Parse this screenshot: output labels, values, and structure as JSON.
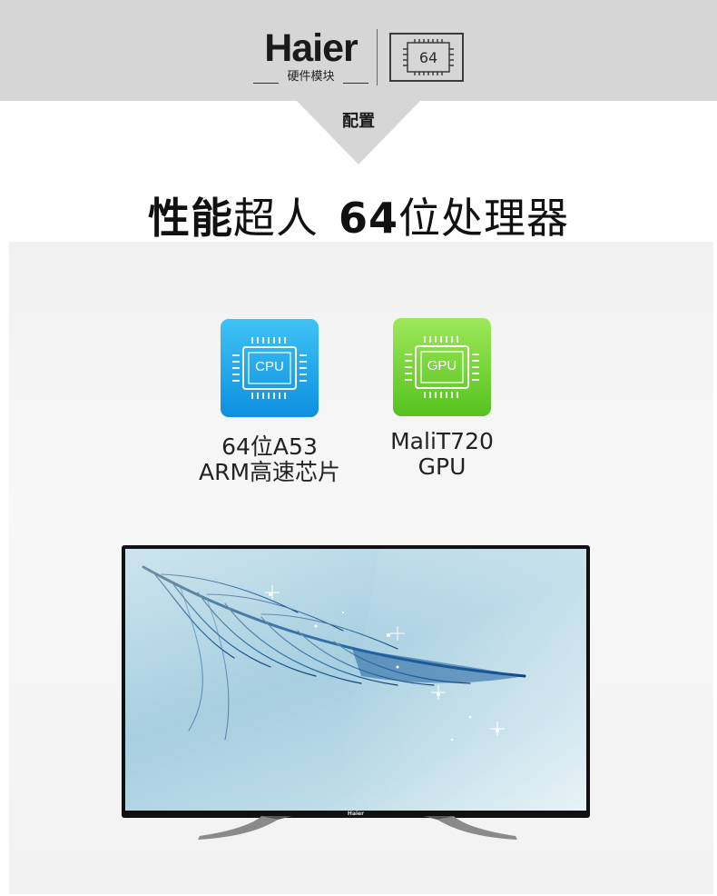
{
  "header": {
    "brand": "Haier",
    "subtitle": "硬件模块",
    "badge_number": "64",
    "tab_label": "配置",
    "colors": {
      "band": "#d6d6d6"
    }
  },
  "headline": {
    "bold1": "性能",
    "normal1": "超人",
    "bold2": "64",
    "normal2": "位处理器"
  },
  "features": [
    {
      "icon": "cpu-chip-icon",
      "chip_label": "CPU",
      "line1": "64位A53",
      "line2": "ARM高速芯片",
      "color": "#1aa3ea"
    },
    {
      "icon": "gpu-chip-icon",
      "chip_label": "GPU",
      "line1": "MaliT720",
      "line2": "GPU",
      "color": "#6fd235"
    }
  ],
  "tv": {
    "logo": "Haier"
  }
}
